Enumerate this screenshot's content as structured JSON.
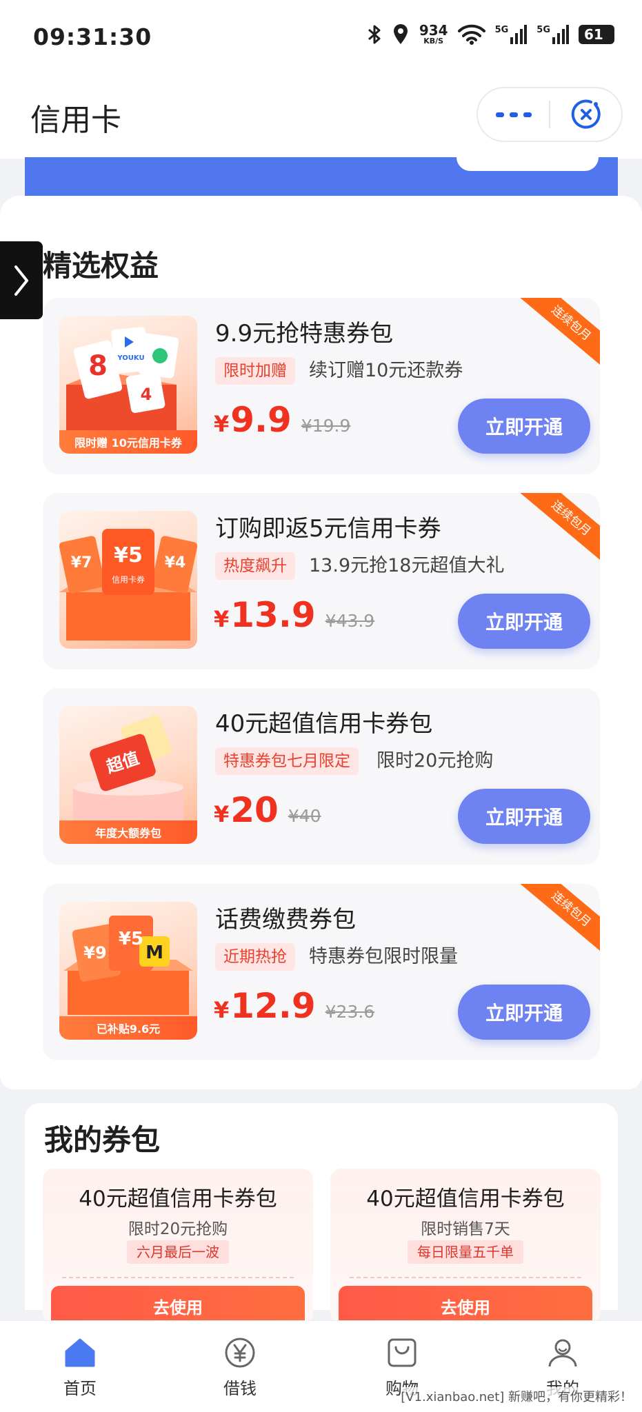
{
  "status_bar": {
    "time": "09:31:30",
    "net_speed_value": "934",
    "net_speed_unit": "KB/S",
    "signal_1": "5G",
    "signal_2": "5G",
    "battery": "61"
  },
  "header": {
    "title": "信用卡"
  },
  "benefits": {
    "title": "精选权益",
    "ribbon": "连续包月",
    "items": [
      {
        "title": "9.9元抢特惠券包",
        "badge": "限时加赠",
        "subtitle": "续订赠10元还款券",
        "price": "9.9",
        "original_price": "¥19.9",
        "button": "立即开通",
        "thumb_caption": "限时赠 10元信用卡券",
        "thumb_text": "YOUKU",
        "thumb_num_a": "8",
        "thumb_num_b": "4",
        "has_ribbon": true
      },
      {
        "title": "订购即返5元信用卡券",
        "badge": "热度飙升",
        "subtitle": "13.9元抢18元超值大礼",
        "price": "13.9",
        "original_price": "¥43.9",
        "button": "立即开通",
        "thumb_caption": "",
        "thumb_text": "信用卡券",
        "thumb_num_a": "¥5",
        "thumb_num_b": "¥4",
        "thumb_num_c": "¥7",
        "has_ribbon": true
      },
      {
        "title": "40元超值信用卡券包",
        "badge": "特惠券包七月限定",
        "subtitle": "限时20元抢购",
        "price": "20",
        "original_price": "¥40",
        "button": "立即开通",
        "thumb_caption": "年度大额券包",
        "thumb_text": "超值",
        "has_ribbon": false
      },
      {
        "title": "话费缴费券包",
        "badge": "近期热抢",
        "subtitle": "特惠券包限时限量",
        "price": "12.9",
        "original_price": "¥23.6",
        "button": "立即开通",
        "thumb_caption": "已补贴9.6元",
        "thumb_text": "M",
        "thumb_num_a": "¥9",
        "thumb_num_b": "¥5",
        "has_ribbon": true
      }
    ]
  },
  "my_coupons": {
    "title": "我的券包",
    "items": [
      {
        "title": "40元超值信用卡券包",
        "subtitle": "限时20元抢购",
        "tag": "六月最后一波",
        "button": "去使用"
      },
      {
        "title": "40元超值信用卡券包",
        "subtitle": "限时销售7天",
        "tag": "每日限量五千单",
        "button": "去使用"
      }
    ]
  },
  "tabbar": {
    "items": [
      {
        "label": "首页",
        "icon": "home-icon"
      },
      {
        "label": "借钱",
        "icon": "yen-icon"
      },
      {
        "label": "购物",
        "icon": "bag-icon"
      },
      {
        "label": "我的",
        "icon": "user-icon"
      }
    ]
  },
  "watermark": "[V1.xianbao.net] 新赚吧，有你更精彩！",
  "colors": {
    "accent": "#6e82f2",
    "price": "#f0311f",
    "ribbon": "#ff6a17",
    "banner": "#5177ee",
    "brand_blue": "#1f5fe6"
  }
}
